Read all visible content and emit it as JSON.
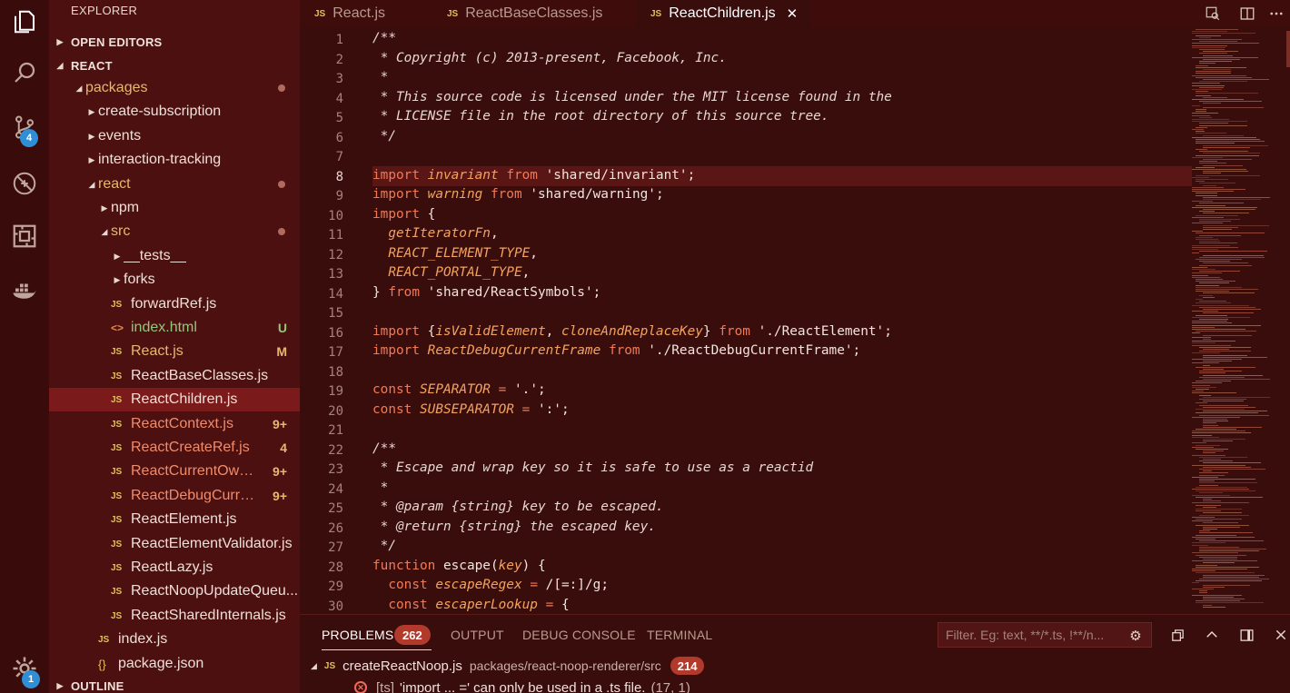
{
  "activity_bar": {
    "source_control_badge": "4",
    "settings_badge": "1"
  },
  "sidebar": {
    "title": "EXPLORER",
    "open_editors": "OPEN EDITORS",
    "root": "REACT",
    "outline": "OUTLINE",
    "tree": [
      {
        "label": "packages",
        "type": "folder",
        "state": "open",
        "level": 0,
        "deco": "dot",
        "color": "mod"
      },
      {
        "label": "create-subscription",
        "type": "folder",
        "state": "closed",
        "level": 1
      },
      {
        "label": "events",
        "type": "folder",
        "state": "closed",
        "level": 1
      },
      {
        "label": "interaction-tracking",
        "type": "folder",
        "state": "closed",
        "level": 1
      },
      {
        "label": "react",
        "type": "folder",
        "state": "open",
        "level": 1,
        "deco": "dot",
        "color": "mod"
      },
      {
        "label": "npm",
        "type": "folder",
        "state": "closed",
        "level": 2
      },
      {
        "label": "src",
        "type": "folder",
        "state": "open",
        "level": 2,
        "deco": "dot",
        "color": "mod"
      },
      {
        "label": "__tests__",
        "type": "folder",
        "state": "closed",
        "level": 3
      },
      {
        "label": "forks",
        "type": "folder",
        "state": "closed",
        "level": 3
      },
      {
        "label": "forwardRef.js",
        "type": "js",
        "level": 3
      },
      {
        "label": "index.html",
        "type": "html",
        "level": 3,
        "deco": "U",
        "color": "new"
      },
      {
        "label": "React.js",
        "type": "js",
        "level": 3,
        "deco": "M"
      },
      {
        "label": "ReactBaseClasses.js",
        "type": "js",
        "level": 3
      },
      {
        "label": "ReactChildren.js",
        "type": "js",
        "level": 3,
        "selected": true
      },
      {
        "label": "ReactContext.js",
        "type": "js",
        "level": 3,
        "deco": "9+",
        "color": "err"
      },
      {
        "label": "ReactCreateRef.js",
        "type": "js",
        "level": 3,
        "deco": "4",
        "color": "err"
      },
      {
        "label": "ReactCurrentOwne...",
        "type": "js",
        "level": 3,
        "deco": "9+",
        "color": "err"
      },
      {
        "label": "ReactDebugCurre...",
        "type": "js",
        "level": 3,
        "deco": "9+",
        "color": "err"
      },
      {
        "label": "ReactElement.js",
        "type": "js",
        "level": 3
      },
      {
        "label": "ReactElementValidator.js",
        "type": "js",
        "level": 3
      },
      {
        "label": "ReactLazy.js",
        "type": "js",
        "level": 3
      },
      {
        "label": "ReactNoopUpdateQueu...",
        "type": "js",
        "level": 3
      },
      {
        "label": "ReactSharedInternals.js",
        "type": "js",
        "level": 3
      },
      {
        "label": "index.js",
        "type": "js",
        "level": 2
      },
      {
        "label": "package.json",
        "type": "json",
        "level": 2
      }
    ]
  },
  "tabs": [
    {
      "label": "React.js",
      "active": false
    },
    {
      "label": "ReactBaseClasses.js",
      "active": false
    },
    {
      "label": "ReactChildren.js",
      "active": true
    }
  ],
  "editor": {
    "current_line": 8,
    "lines": [
      {
        "n": "1",
        "t": "/**"
      },
      {
        "n": "2",
        "t": " * Copyright (c) 2013-present, Facebook, Inc."
      },
      {
        "n": "3",
        "t": " *"
      },
      {
        "n": "4",
        "t": " * This source code is licensed under the MIT license found in the"
      },
      {
        "n": "5",
        "t": " * LICENSE file in the root directory of this source tree."
      },
      {
        "n": "6",
        "t": " */"
      },
      {
        "n": "7",
        "t": ""
      },
      {
        "n": "8",
        "t": "import invariant from 'shared/invariant';"
      },
      {
        "n": "9",
        "t": "import warning from 'shared/warning';"
      },
      {
        "n": "10",
        "t": "import {"
      },
      {
        "n": "11",
        "t": "  getIteratorFn,"
      },
      {
        "n": "12",
        "t": "  REACT_ELEMENT_TYPE,"
      },
      {
        "n": "13",
        "t": "  REACT_PORTAL_TYPE,"
      },
      {
        "n": "14",
        "t": "} from 'shared/ReactSymbols';"
      },
      {
        "n": "15",
        "t": ""
      },
      {
        "n": "16",
        "t": "import {isValidElement, cloneAndReplaceKey} from './ReactElement';"
      },
      {
        "n": "17",
        "t": "import ReactDebugCurrentFrame from './ReactDebugCurrentFrame';"
      },
      {
        "n": "18",
        "t": ""
      },
      {
        "n": "19",
        "t": "const SEPARATOR = '.';"
      },
      {
        "n": "20",
        "t": "const SUBSEPARATOR = ':';"
      },
      {
        "n": "21",
        "t": ""
      },
      {
        "n": "22",
        "t": "/**"
      },
      {
        "n": "23",
        "t": " * Escape and wrap key so it is safe to use as a reactid"
      },
      {
        "n": "24",
        "t": " *"
      },
      {
        "n": "25",
        "t": " * @param {string} key to be escaped."
      },
      {
        "n": "26",
        "t": " * @return {string} the escaped key."
      },
      {
        "n": "27",
        "t": " */"
      },
      {
        "n": "28",
        "t": "function escape(key) {"
      },
      {
        "n": "29",
        "t": "  const escapeRegex = /[=:]/g;"
      },
      {
        "n": "30",
        "t": "  const escaperLookup = {"
      }
    ]
  },
  "panel": {
    "tabs": {
      "problems": "PROBLEMS",
      "problems_count": "262",
      "output": "OUTPUT",
      "debug_console": "DEBUG CONSOLE",
      "terminal": "TERMINAL"
    },
    "filter_placeholder": "Filter. Eg: text, **/*.ts, !**/n...",
    "problem_group": {
      "file": "createReactNoop.js",
      "path": "packages/react-noop-renderer/src",
      "count": "214"
    },
    "problem_item": {
      "source": "[ts]",
      "message": "'import ... =' can only be used in a .ts file.",
      "location": "(17, 1)"
    }
  },
  "colors": {
    "background": "#3a0d0d",
    "sidebar": "#4d1010",
    "keyword": "#f07a56",
    "variable": "#f3a35e",
    "badge_blue": "#2f8fd6",
    "badge_red": "#b23a2c"
  }
}
